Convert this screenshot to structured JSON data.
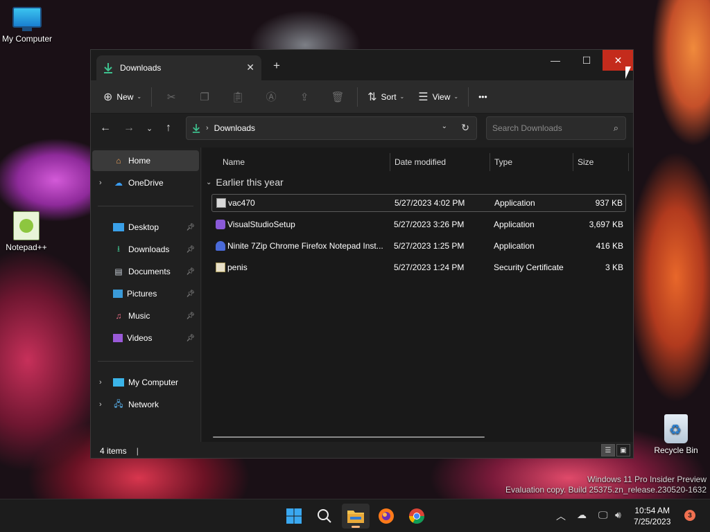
{
  "desktop": {
    "icons": [
      {
        "label": "My Computer"
      },
      {
        "label": "Notepad++"
      },
      {
        "label": "Recycle Bin"
      }
    ],
    "watermark": {
      "line1": "Windows 11 Pro Insider Preview",
      "line2": "Evaluation copy. Build 25375.zn_release.230520-1632"
    }
  },
  "window": {
    "tab": {
      "title": "Downloads",
      "close_glyph": "✕",
      "icon": "download-icon"
    },
    "new_tab_glyph": "+",
    "controls": {
      "minimize": "—",
      "maximize": "☐",
      "close": "✕"
    },
    "toolbar": {
      "new_label": "New",
      "sort_label": "Sort",
      "view_label": "View",
      "more_glyph": "•••"
    },
    "address": {
      "crumb": "Downloads",
      "search_placeholder": "Search Downloads"
    },
    "sidebar": {
      "items": [
        {
          "label": "Home",
          "icon": "home-icon",
          "selected": true
        },
        {
          "label": "OneDrive",
          "icon": "cloud-icon"
        },
        {
          "label": "Desktop",
          "icon": "desktop-icon",
          "pinned": true
        },
        {
          "label": "Downloads",
          "icon": "download-icon",
          "pinned": true
        },
        {
          "label": "Documents",
          "icon": "document-icon",
          "pinned": true
        },
        {
          "label": "Pictures",
          "icon": "picture-icon",
          "pinned": true
        },
        {
          "label": "Music",
          "icon": "music-icon",
          "pinned": true
        },
        {
          "label": "Videos",
          "icon": "video-icon",
          "pinned": true
        },
        {
          "label": "My Computer",
          "icon": "computer-icon"
        },
        {
          "label": "Network",
          "icon": "network-icon"
        }
      ]
    },
    "columns": {
      "name": "Name",
      "date": "Date modified",
      "type": "Type",
      "size": "Size"
    },
    "group_label": "Earlier this year",
    "files": [
      {
        "name": "vac470",
        "date": "5/27/2023 4:02 PM",
        "type": "Application",
        "size": "937 KB",
        "icon": "app-icon",
        "selected": true
      },
      {
        "name": "VisualStudioSetup",
        "date": "5/27/2023 3:26 PM",
        "type": "Application",
        "size": "3,697 KB",
        "icon": "visual-studio-icon"
      },
      {
        "name": "Ninite 7Zip Chrome Firefox Notepad Inst...",
        "date": "5/27/2023 1:25 PM",
        "type": "Application",
        "size": "416 KB",
        "icon": "ninite-icon"
      },
      {
        "name": "penis",
        "date": "5/27/2023 1:24 PM",
        "type": "Security Certificate",
        "size": "3 KB",
        "icon": "certificate-icon"
      }
    ],
    "status": {
      "item_count": "4 items",
      "cursor": "|"
    }
  },
  "taskbar": {
    "apps": [
      "start-icon",
      "search-icon",
      "file-explorer-icon",
      "firefox-icon",
      "chrome-icon"
    ],
    "clock": {
      "time": "10:54 AM",
      "date": "7/25/2023"
    },
    "notification_count": "3"
  },
  "colors": {
    "close_red": "#c42b1c",
    "accent_green": "#3ec28f",
    "window_bg": "#202020"
  }
}
